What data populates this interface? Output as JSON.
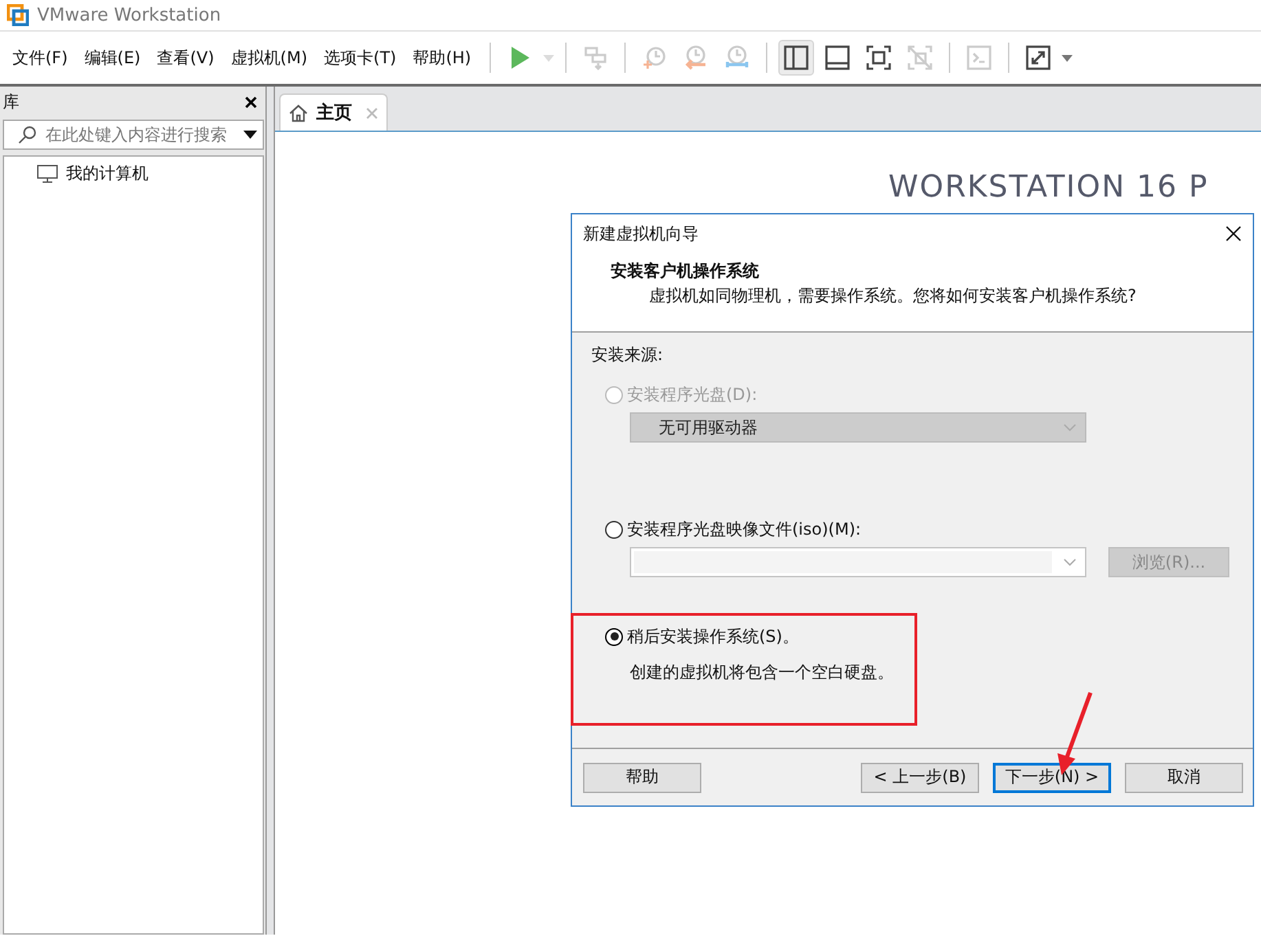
{
  "window": {
    "title": "VMware Workstation"
  },
  "menu": [
    "文件(F)",
    "编辑(E)",
    "查看(V)",
    "虚拟机(M)",
    "选项卡(T)",
    "帮助(H)"
  ],
  "toolbar": [
    [
      {
        "kind": "play",
        "disabled": false
      },
      {
        "kind": "caret",
        "disabled": true
      }
    ],
    [
      {
        "kind": "send-keys",
        "disabled": true
      }
    ],
    [
      {
        "kind": "snapshot-take",
        "disabled": true
      },
      {
        "kind": "snapshot-revert",
        "disabled": true
      },
      {
        "kind": "snapshot-manage",
        "disabled": true
      }
    ],
    [
      {
        "kind": "view-library",
        "disabled": false,
        "selected": true
      },
      {
        "kind": "view-thumbnail",
        "disabled": false,
        "selected": false
      },
      {
        "kind": "view-fullscreen",
        "disabled": false,
        "selected": false
      },
      {
        "kind": "view-unity",
        "disabled": true,
        "selected": false
      }
    ],
    [
      {
        "kind": "console",
        "disabled": true
      }
    ],
    [
      {
        "kind": "stretch",
        "disabled": false
      },
      {
        "kind": "caret",
        "disabled": false
      }
    ]
  ],
  "library": {
    "title": "库",
    "search": {
      "placeholder": "在此处键入内容进行搜索"
    },
    "tree": [
      {
        "label": "我的计算机"
      }
    ]
  },
  "tabs": [
    {
      "label": "主页",
      "selected": true
    }
  ],
  "home": {
    "banner": "WORKSTATION 16 P"
  },
  "dialog": {
    "title": "新建虚拟机向导",
    "heading": "安装客户机操作系统",
    "subheading": "虚拟机如同物理机，需要操作系统。您将如何安装客户机操作系统?",
    "section_label": "安装来源:",
    "options": [
      {
        "kind": "drive",
        "label": "安装程序光盘(D):",
        "selected": false,
        "disabled": true,
        "select": {
          "value": "无可用驱动器",
          "disabled": true
        }
      },
      {
        "kind": "iso",
        "label": "安装程序光盘映像文件(iso)(M):",
        "selected": false,
        "disabled": false,
        "browse": {
          "label": "浏览(R)...",
          "disabled": true
        }
      },
      {
        "kind": "later",
        "label": "稍后安装操作系统(S)。",
        "selected": true,
        "disabled": false,
        "note": "创建的虚拟机将包含一个空白硬盘。"
      }
    ],
    "buttons": [
      {
        "kind": "help",
        "label": "帮助",
        "focused": false
      },
      {
        "kind": "nav",
        "label": "< 上一步(B)",
        "focused": false
      },
      {
        "kind": "nav",
        "label": "下一步(N) >",
        "focused": true
      },
      {
        "kind": "nav",
        "label": "取消",
        "focused": false
      }
    ]
  }
}
